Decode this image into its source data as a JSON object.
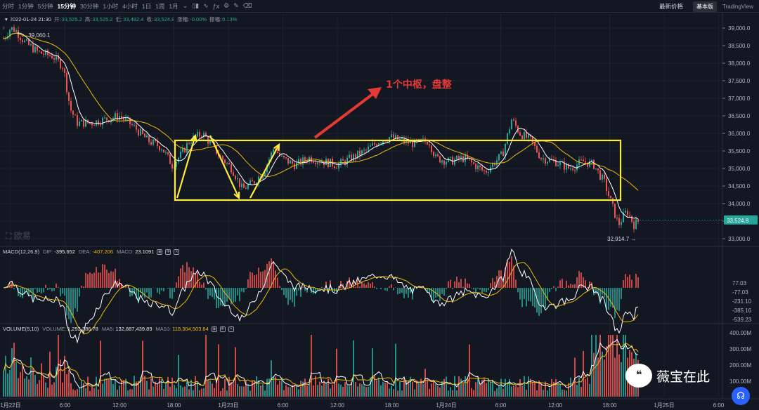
{
  "toolbar": {
    "timeframes": [
      "分时",
      "1分钟",
      "5分钟",
      "15分钟",
      "30分钟",
      "1小时",
      "4小时",
      "1日",
      "1周",
      "1月"
    ],
    "active_timeframe": "15分钟",
    "latest_price_label": "最新价格",
    "basic_label": "基本版",
    "tradingview_label": "TradingView"
  },
  "ohlc": {
    "datetime": "2022-01-24 21:30",
    "open_label": "开:",
    "open": "33,525.2",
    "high_label": "高:",
    "high": "33,525.2",
    "low_label": "低:",
    "low": "33,482.4",
    "close_label": "收:",
    "close": "33,524.8",
    "change_label": "涨幅:",
    "change": "-0.00%",
    "amplitude_label": "振幅:",
    "amplitude": "0.13%"
  },
  "macd": {
    "name": "MACD(12,26,9)",
    "dif_label": "DIF:",
    "dif": "-395.652",
    "dea_label": "DEA:",
    "dea": "-407.206",
    "macd_label": "MACD:",
    "macd": "23.1091"
  },
  "volume": {
    "name": "VOLUME(5,10)",
    "vol_label": "VOLUME:",
    "vol": "1,293,386.78",
    "ma5_label": "MA5:",
    "ma5": "132,887,439.89",
    "ma10_label": "MA10:",
    "ma10": "118,304,503.64"
  },
  "annotation": {
    "text": "1个中枢，盘整"
  },
  "watermark": {
    "text": "薇宝在此"
  },
  "chart_data": {
    "type": "candlestick",
    "price_axis_ticks": [
      "39,000.0",
      "38,500.0",
      "38,000.0",
      "37,500.0",
      "37,000.0",
      "36,500.0",
      "36,000.0",
      "35,500.0",
      "35,000.0",
      "34,500.0",
      "34,000.0",
      "33,500.0",
      "33,000.0"
    ],
    "price_range": [
      32800,
      39400
    ],
    "current_price": "33,524.8",
    "high_marker": "39,060.1",
    "low_marker": "32,914.7",
    "time_ticks": [
      "1月22日",
      "6:00",
      "12:00",
      "18:00",
      "1月23日",
      "6:00",
      "12:00",
      "18:00",
      "1月24日",
      "6:00",
      "12:00",
      "18:00",
      "1月25日",
      "6:00"
    ],
    "macd_axis_ticks": [
      "77.03",
      "-77.03",
      "-231.10",
      "-385.16",
      "-539.23"
    ],
    "volume_axis_ticks": [
      "400.00M",
      "300.00M",
      "200.00M",
      "100.00M"
    ],
    "consolidation_box": {
      "price_top": 35800,
      "price_bottom": 34100
    },
    "colors": {
      "up": "#26a69a",
      "down": "#ef5350",
      "ma_fast": "#ffffff",
      "ma_slow": "#f0b90b",
      "box": "#ffeb3b",
      "arrow": "#e53935",
      "current_price_bg": "#26a69a"
    }
  }
}
